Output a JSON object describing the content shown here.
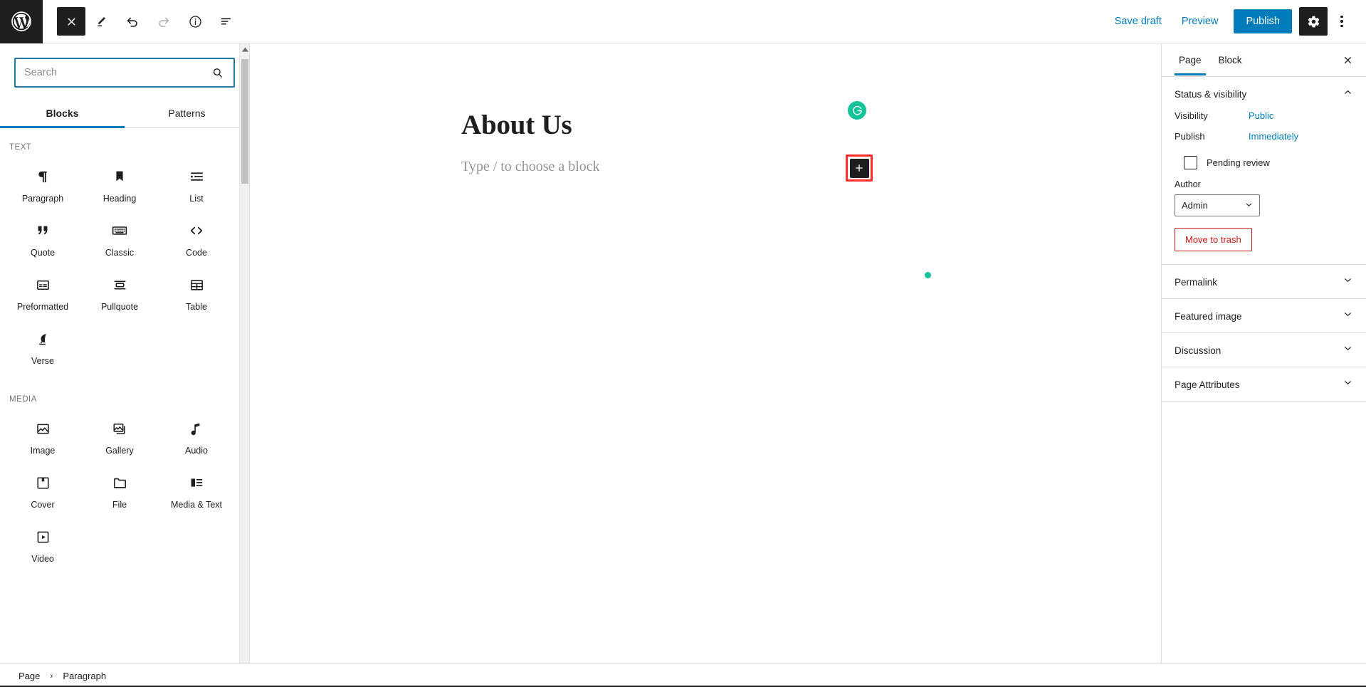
{
  "topbar": {
    "logo_icon": "wordpress-logo-icon",
    "close_icon": "close-icon",
    "edit_icon": "pencil-edit-icon",
    "undo_icon": "undo-arrow-icon",
    "redo_icon": "redo-arrow-icon",
    "info_icon": "info-circle-icon",
    "listview_icon": "list-view-icon",
    "save_draft_label": "Save draft",
    "preview_label": "Preview",
    "publish_label": "Publish",
    "settings_icon": "gear-icon",
    "options_icon": "kebab-more-icon",
    "accent_blue": "#007cba",
    "dark": "#1e1e1e"
  },
  "inserter": {
    "search": {
      "value": "",
      "placeholder": "Search",
      "icon": "search-icon"
    },
    "tabs": [
      {
        "label": "Blocks",
        "active": true
      },
      {
        "label": "Patterns",
        "active": false
      }
    ],
    "categories": [
      {
        "label": "TEXT",
        "blocks": [
          {
            "label": "Paragraph",
            "icon": "paragraph-pilcrow-icon"
          },
          {
            "label": "Heading",
            "icon": "heading-bookmark-icon"
          },
          {
            "label": "List",
            "icon": "list-bullets-icon"
          },
          {
            "label": "Quote",
            "icon": "quote-marks-icon"
          },
          {
            "label": "Classic",
            "icon": "keyboard-icon"
          },
          {
            "label": "Code",
            "icon": "angle-brackets-icon"
          },
          {
            "label": "Preformatted",
            "icon": "preformatted-box-icon"
          },
          {
            "label": "Pullquote",
            "icon": "pullquote-lines-icon"
          },
          {
            "label": "Table",
            "icon": "table-grid-icon"
          },
          {
            "label": "Verse",
            "icon": "verse-feather-icon"
          }
        ]
      },
      {
        "label": "MEDIA",
        "blocks": [
          {
            "label": "Image",
            "icon": "image-picture-icon"
          },
          {
            "label": "Gallery",
            "icon": "gallery-stack-icon"
          },
          {
            "label": "Audio",
            "icon": "audio-note-icon"
          },
          {
            "label": "Cover",
            "icon": "cover-bookmark-icon"
          },
          {
            "label": "File",
            "icon": "file-folder-icon"
          },
          {
            "label": "Media & Text",
            "icon": "media-text-icon"
          },
          {
            "label": "Video",
            "icon": "video-play-icon"
          }
        ]
      }
    ],
    "scrollbar": {
      "up_icon": "scroll-up-arrow-icon",
      "down_icon": "scroll-down-arrow-icon"
    }
  },
  "canvas": {
    "post_title": "About Us",
    "block_placeholder": "Type / to choose a block",
    "grammarly_icon": "grammarly-g-icon",
    "grammarly_color": "#15c39a",
    "add_block_icon": "plus-icon",
    "highlight_color": "#ff2d2d"
  },
  "sidebar": {
    "tabs": [
      {
        "label": "Page",
        "active": true
      },
      {
        "label": "Block",
        "active": false
      }
    ],
    "close_icon": "close-icon",
    "status_panel": {
      "title": "Status & visibility",
      "collapse_icon": "chevron-up-icon",
      "visibility_label": "Visibility",
      "visibility_value": "Public",
      "publish_label": "Publish",
      "publish_value": "Immediately",
      "pending_review_label": "Pending review",
      "pending_review_checked": false,
      "author_label": "Author",
      "author_value": "Admin",
      "author_chevron_icon": "chevron-down-icon",
      "trash_label": "Move to trash",
      "trash_color": "#cc1818"
    },
    "panels": [
      {
        "title": "Permalink",
        "icon": "chevron-down-icon"
      },
      {
        "title": "Featured image",
        "icon": "chevron-down-icon"
      },
      {
        "title": "Discussion",
        "icon": "chevron-down-icon"
      },
      {
        "title": "Page Attributes",
        "icon": "chevron-down-icon"
      }
    ]
  },
  "breadcrumb": {
    "items": [
      "Page",
      "Paragraph"
    ],
    "separator": "›"
  }
}
